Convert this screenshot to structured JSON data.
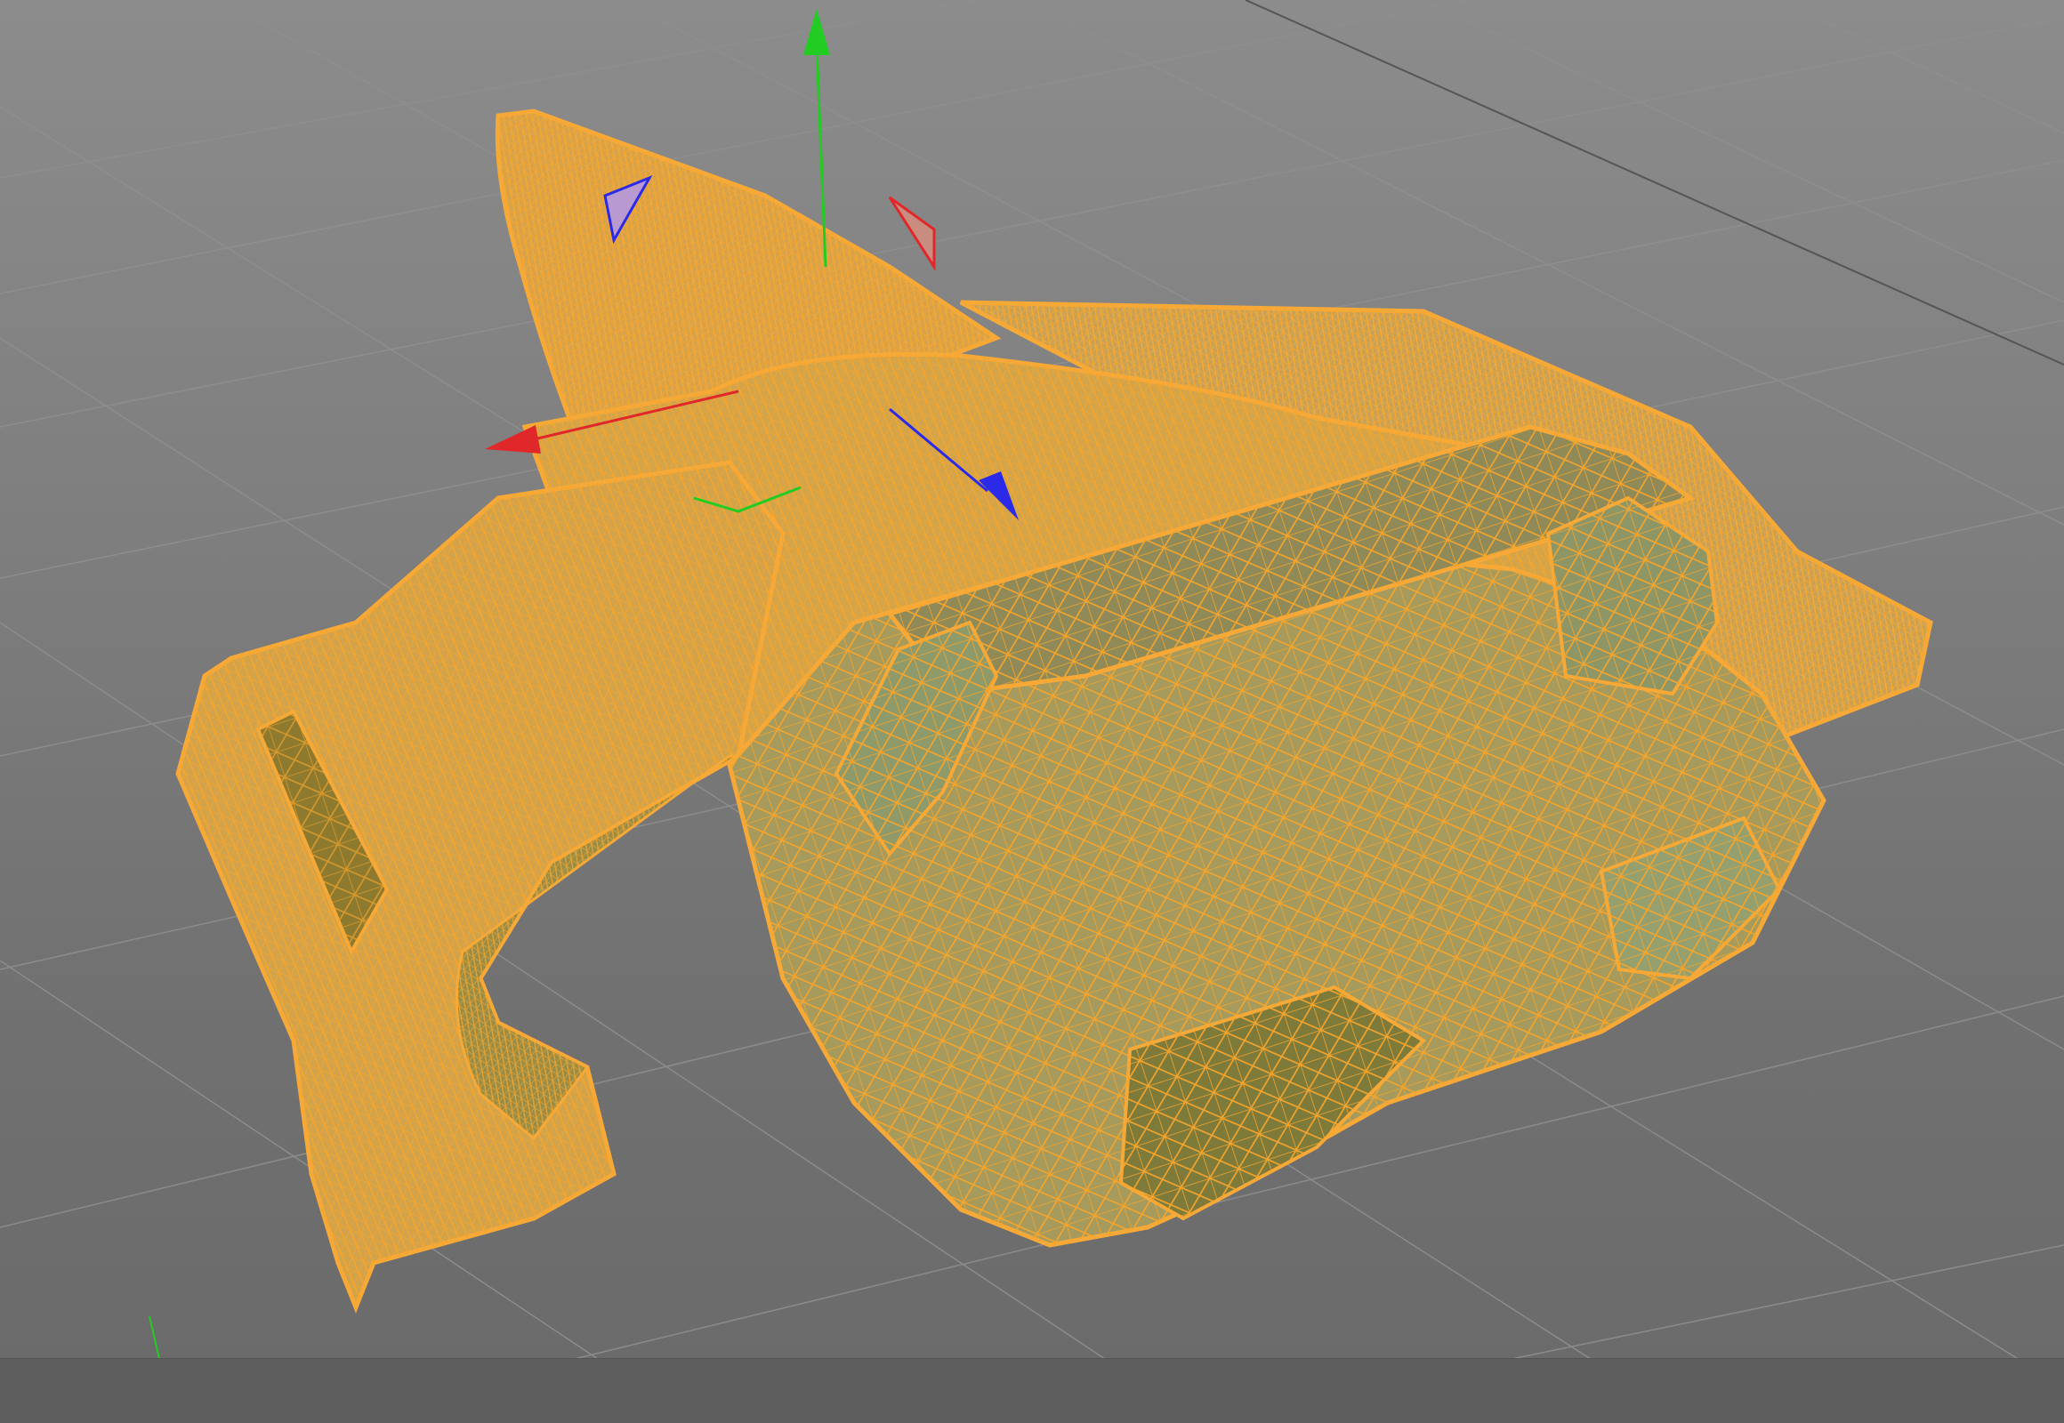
{
  "viewport": {
    "view": "perspective",
    "display_mode": "wireframe",
    "selection_color": "#f7a938",
    "background_color": "#7a7a7a",
    "grid_color": "#8e8e8e"
  },
  "object": {
    "selected": true,
    "shading": "lines"
  },
  "axis_gizmo": {
    "x_color": "#e0282a",
    "y_color": "#22cc22",
    "z_color": "#2a2ae8"
  },
  "world_axis_icon": "xyz-axis-icon"
}
